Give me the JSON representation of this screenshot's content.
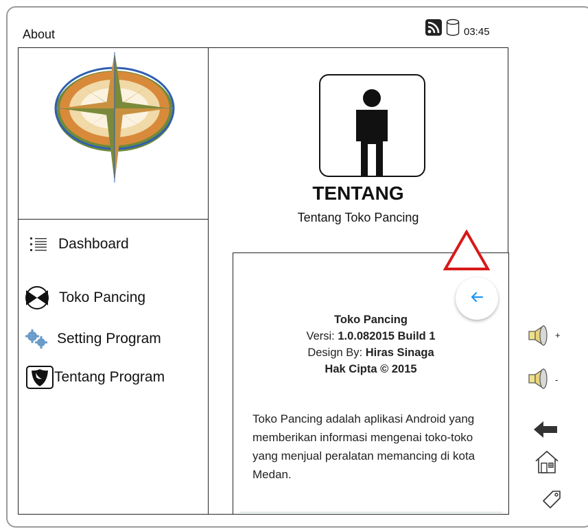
{
  "window": {
    "title": "About"
  },
  "status_bar": {
    "time": "03:45",
    "icons": [
      "rss-icon",
      "database-icon"
    ]
  },
  "sidebar": {
    "logo": "compass-rose-logo",
    "items": [
      {
        "label": "Dashboard",
        "icon": "list-icon"
      },
      {
        "label": "Toko Pancing",
        "icon": "bowtie-icon"
      },
      {
        "label": "Setting Program",
        "icon": "gears-icon"
      },
      {
        "label": "Tentang Program",
        "icon": "shield-icon"
      }
    ]
  },
  "header": {
    "icon": "person-icon",
    "title": "TENTANG",
    "subtitle": "Tentang Toko Pancing"
  },
  "about": {
    "app_name": "Toko Pancing",
    "version_label": "Versi: ",
    "version_value": "1.0.082015 Build 1",
    "design_label": "Design By: ",
    "design_value": "Hiras Sinaga",
    "copyright": "Hak Cipta © 2015",
    "description": "Toko Pancing adalah aplikasi Android yang memberikan informasi mengenai toko-toko yang menjual peralatan memancing di kota Medan."
  },
  "device_controls": {
    "volume_up_label": "+",
    "volume_down_label": "-",
    "buttons": [
      "volume-up",
      "volume-down",
      "back",
      "home",
      "tag"
    ]
  },
  "colors": {
    "warning": "#e02020",
    "accent": "#2196f3"
  }
}
